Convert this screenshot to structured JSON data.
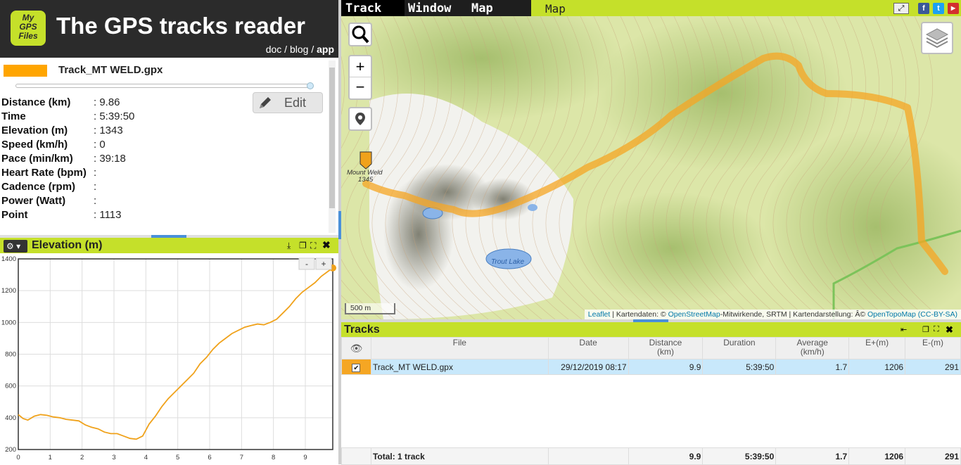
{
  "app": {
    "logo_lines": [
      "My",
      "GPS",
      "Files"
    ],
    "title": "The GPS tracks reader",
    "nav": {
      "doc": "doc",
      "sep": " / ",
      "blog": "blog",
      "app": "app"
    }
  },
  "track_panel": {
    "file_name": "Track_MT WELD.gpx",
    "edit_label": "Edit",
    "stats": [
      {
        "label": "Distance (km)",
        "value": ": 9.86"
      },
      {
        "label": "Time",
        "value": ": 5:39:50"
      },
      {
        "label": "Elevation (m)",
        "value": ": 1343"
      },
      {
        "label": "Speed (km/h)",
        "value": ": 0"
      },
      {
        "label": "Pace (min/km)",
        "value": ": 39:18"
      },
      {
        "label": "Heart Rate (bpm)",
        "value": ":"
      },
      {
        "label": "Cadence (rpm)",
        "value": ":"
      },
      {
        "label": "Power (Watt)",
        "value": ":"
      },
      {
        "label": "Point",
        "value": ": 1113"
      }
    ]
  },
  "elevation_panel": {
    "title": "Elevation (m)",
    "zoom_minus": "-",
    "zoom_plus": "+"
  },
  "chart_data": {
    "type": "line",
    "title": "Elevation (m)",
    "xlabel": "",
    "ylabel": "",
    "xlim": [
      0,
      9.86
    ],
    "ylim": [
      200,
      1400
    ],
    "x_ticks": [
      "0",
      "1",
      "2",
      "3",
      "4",
      "5",
      "6",
      "7",
      "8",
      "9"
    ],
    "y_ticks": [
      "200",
      "400",
      "600",
      "800",
      "1000",
      "1200",
      "1400"
    ],
    "grid": true,
    "series": [
      {
        "color": "#f0a21b",
        "x": [
          0,
          0.15,
          0.3,
          0.5,
          0.7,
          0.9,
          1.1,
          1.3,
          1.5,
          1.7,
          1.9,
          2.1,
          2.3,
          2.5,
          2.7,
          2.9,
          3.1,
          3.3,
          3.5,
          3.7,
          3.9,
          4.1,
          4.3,
          4.5,
          4.7,
          4.9,
          5.1,
          5.3,
          5.5,
          5.7,
          5.9,
          6.1,
          6.3,
          6.5,
          6.7,
          6.9,
          7.1,
          7.3,
          7.5,
          7.7,
          7.9,
          8.1,
          8.3,
          8.5,
          8.7,
          8.9,
          9.1,
          9.3,
          9.5,
          9.7,
          9.86
        ],
        "y": [
          420,
          395,
          385,
          410,
          420,
          415,
          405,
          400,
          390,
          385,
          380,
          355,
          340,
          330,
          310,
          300,
          300,
          285,
          270,
          265,
          285,
          360,
          410,
          470,
          520,
          560,
          600,
          640,
          680,
          740,
          780,
          830,
          870,
          900,
          930,
          950,
          970,
          980,
          990,
          985,
          1000,
          1020,
          1060,
          1100,
          1150,
          1190,
          1220,
          1250,
          1290,
          1320,
          1343
        ]
      }
    ]
  },
  "menu": {
    "track": "Track",
    "window": "Window",
    "map": "Map"
  },
  "map_panel": {
    "title": "Map",
    "zoom_in": "+",
    "zoom_out": "−",
    "scale": "500 m",
    "labels": {
      "peak_name": "Mount Weld",
      "peak_elev": "1345",
      "lake": "Trout Lake"
    },
    "attribution": {
      "leaflet": "Leaflet",
      "t1": " | Kartendaten: © ",
      "osm": "OpenStreetMap",
      "t2": "-Mitwirkende, SRTM | Kartendarstellung: Â© ",
      "otm": "OpenTopoMap",
      "t3": " ",
      "license": "(CC-BY-SA)"
    },
    "track_color": "#f5a623"
  },
  "tracks_panel": {
    "title": "Tracks",
    "columns": [
      "File",
      "Date",
      "Distance (km)",
      "Duration",
      "Average (km/h)",
      "E+(m)",
      "E-(m)"
    ],
    "columns_display": [
      {
        "line1": "File",
        "line2": ""
      },
      {
        "line1": "Date",
        "line2": ""
      },
      {
        "line1": "Distance",
        "line2": "(km)"
      },
      {
        "line1": "Duration",
        "line2": ""
      },
      {
        "line1": "Average",
        "line2": "(km/h)"
      },
      {
        "line1": "E+(m)",
        "line2": ""
      },
      {
        "line1": "E-(m)",
        "line2": ""
      }
    ],
    "rows": [
      {
        "file": "Track_MT WELD.gpx",
        "date": "29/12/2019 08:17",
        "distance": "9.9",
        "duration": "5:39:50",
        "average": "1.7",
        "e_plus": "1206",
        "e_minus": "291",
        "checked": true
      }
    ],
    "total": {
      "label": "Total: 1 track",
      "distance": "9.9",
      "duration": "5:39:50",
      "average": "1.7",
      "e_plus": "1206",
      "e_minus": "291"
    }
  },
  "colors": {
    "accent": "#c5e02a",
    "header_bg": "#2b2b2b",
    "track": "#ffa500",
    "selected_row": "#c8e8fb"
  }
}
